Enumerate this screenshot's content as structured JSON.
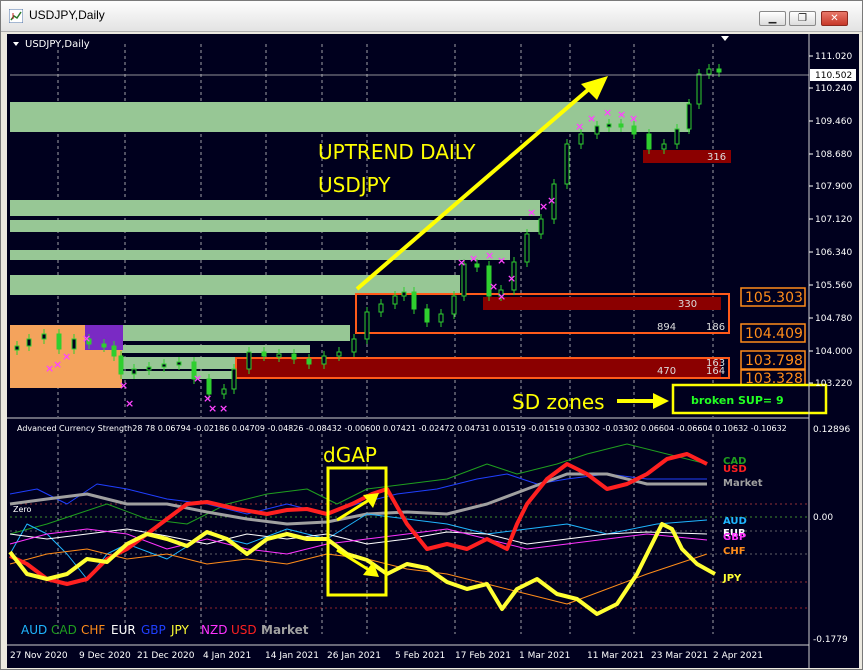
{
  "window": {
    "title": "USDJPY,Daily",
    "buttons": [
      "minimize",
      "restore",
      "close"
    ]
  },
  "main_chart": {
    "symbol_label": "USDJPY,Daily",
    "price_labels": [
      "111.020",
      "110.240",
      "109.460",
      "108.680",
      "107.900",
      "107.120",
      "106.340",
      "105.560",
      "104.780",
      "104.000",
      "103.220"
    ],
    "current_price": "110.502",
    "annotation_uptrend_line1": "UPTREND DAILY",
    "annotation_uptrend_line2": "USDJPY",
    "annotation_sd_zones": "SD zones",
    "broken_support_label": "broken SUP= 9",
    "zone_labels": {
      "z316": "316",
      "z330": "330",
      "z894": "894",
      "z186": "186",
      "z470": "470",
      "z163": "163",
      "z164": "164"
    },
    "zone_price_boxes": [
      "105.303",
      "104.409",
      "103.798",
      "103.328"
    ]
  },
  "indicator": {
    "header": "Advanced Currency Strength28 78 0.06794 -0.02186 0.04709 -0.04826 -0.08432 -0.00600 0.07421 -0.02472 0.04731 0.01519 -0.01519 0.03302 -0.03302 0.06604 -0.06604 0.10632 -0.10632",
    "top_value": "0.12896",
    "zero_value": "0.00",
    "bottom_value": "-0.1779",
    "zero_label": "Zero",
    "dgap_label": "dGAP",
    "right_labels": [
      "CAD",
      "USD",
      "Market",
      "AUD",
      "EUR",
      "GBP",
      "CHF",
      "JPY"
    ],
    "legend": [
      "AUD",
      "CAD",
      "CHF",
      "EUR",
      "GBP",
      "JPY",
      "NZD",
      "USD",
      "Market"
    ]
  },
  "colors": {
    "AUD": "#1fb6ff",
    "CAD": "#1f9e1f",
    "CHF": "#ff8c1a",
    "EUR": "#ffffff",
    "GBP": "#1f3fff",
    "JPY": "#ffff33",
    "NZD": "#ff33ff",
    "USD": "#ff2020",
    "Market": "#a0a0a0",
    "background": "#00001e",
    "demand_zone": "#97c795",
    "supply_zone": "#8b0000",
    "annotation_yellow": "#ffff00"
  },
  "x_axis": {
    "labels": [
      "27 Nov 2020",
      "9 Dec 2020",
      "21 Dec 2020",
      "4 Jan 2021",
      "14 Jan 2021",
      "26 Jan 2021",
      "5 Feb 2021",
      "17 Feb 2021",
      "1 Mar 2021",
      "11 Mar 2021",
      "23 Mar 2021",
      "2 Apr 2021"
    ]
  }
}
